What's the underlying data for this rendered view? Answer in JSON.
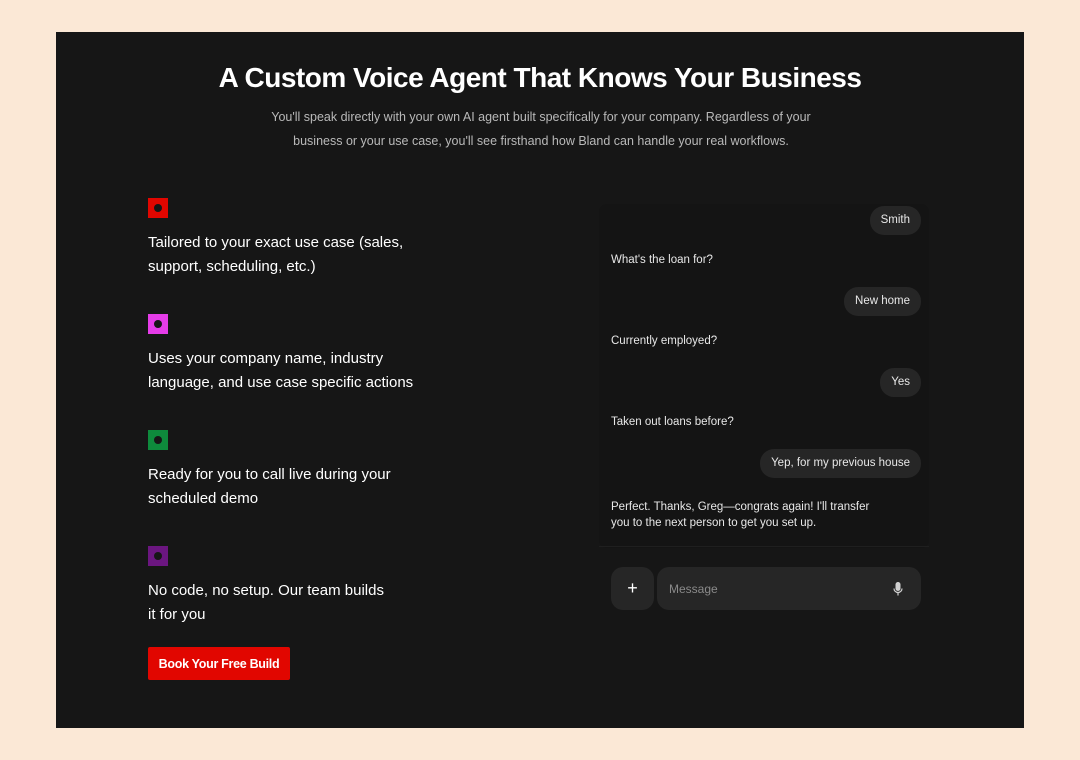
{
  "header": {
    "title": "A Custom Voice Agent That Knows Your Business",
    "subtitle": "You'll speak directly with your own AI agent built specifically for your company. Regardless of your business or your use case, you'll see firsthand how Bland can handle your real workflows."
  },
  "features": [
    {
      "text": "Tailored to your exact use case (sales, support, scheduling, etc.)",
      "color": "#e10600"
    },
    {
      "text": "Uses your company name, industry language, and use case specific actions",
      "color": "#e53ce8"
    },
    {
      "text": "Ready for you to call live during your scheduled demo",
      "color": "#0e8a3c"
    },
    {
      "text": "No code, no setup. Our team builds it for you",
      "color": "#6b1680"
    }
  ],
  "cta": {
    "label": "Book Your Free Build",
    "color": "#e10600"
  },
  "chat": {
    "messages": [
      {
        "role": "user",
        "text": "Smith"
      },
      {
        "role": "agent",
        "text": "What's the loan for?"
      },
      {
        "role": "user",
        "text": "New home"
      },
      {
        "role": "agent",
        "text": "Currently employed?"
      },
      {
        "role": "user",
        "text": "Yes"
      },
      {
        "role": "agent",
        "text": "Taken out loans before?"
      },
      {
        "role": "user",
        "text": "Yep, for my previous house"
      },
      {
        "role": "agent",
        "text": "Perfect. Thanks, Greg—congrats again! I'll transfer you to the next person to get you set up."
      }
    ],
    "plus_label": "+",
    "input_placeholder": "Message",
    "mic_icon": "microphone-icon"
  }
}
